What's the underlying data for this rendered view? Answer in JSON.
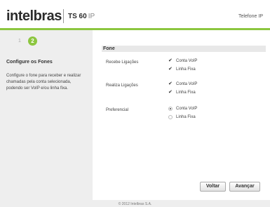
{
  "header": {
    "logo_text": "intelbras",
    "model": "TS 60",
    "model_suffix": "IP",
    "right_title": "Telefone IP"
  },
  "wizard": {
    "step_previous": "1",
    "step_current": "2"
  },
  "sidebar": {
    "title": "Configure os Fones",
    "description": "Configure o fone para receber e realizar chamadas pela conta selecionada, podendo ser VoIP e/ou linha fixa."
  },
  "section": {
    "title": "Fone",
    "rows": [
      {
        "label": "Recebe Ligações",
        "control": "checkbox",
        "options": [
          {
            "label": "Conta VoIP",
            "checked": true
          },
          {
            "label": "Linha Fixa",
            "checked": true
          }
        ]
      },
      {
        "label": "Realiza Ligações",
        "control": "checkbox",
        "options": [
          {
            "label": "Conta VoIP",
            "checked": true
          },
          {
            "label": "Linha Fixa",
            "checked": true
          }
        ]
      },
      {
        "label": "Preferencial",
        "control": "radio",
        "options": [
          {
            "label": "Conta VoIP",
            "checked": true
          },
          {
            "label": "Linha Fixa",
            "checked": false
          }
        ]
      }
    ]
  },
  "buttons": {
    "back": "Voltar",
    "next": "Avançar"
  },
  "footer": {
    "copyright": "© 2012 Intelbras S.A."
  },
  "colors": {
    "accent": "#8cc63f",
    "sidebar_bg": "#eeeeee"
  }
}
